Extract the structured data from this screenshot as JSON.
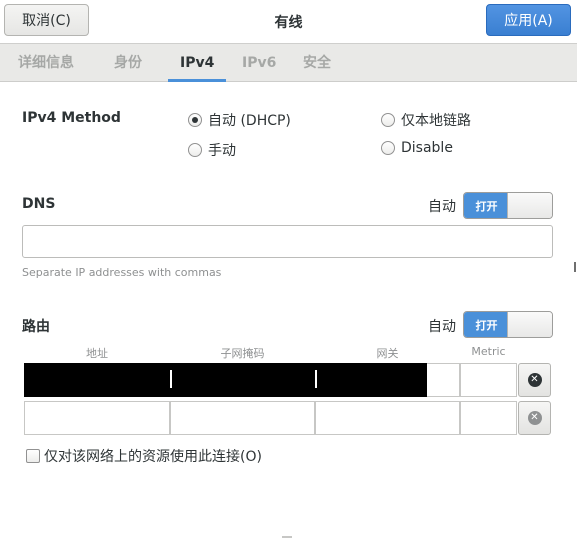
{
  "header": {
    "cancel_label": "取消(C)",
    "title": "有线",
    "apply_label": "应用(A)"
  },
  "tabs": [
    {
      "label": "详细信息",
      "active": false
    },
    {
      "label": "身份",
      "active": false
    },
    {
      "label": "IPv4",
      "active": true
    },
    {
      "label": "IPv6",
      "active": false
    },
    {
      "label": "安全",
      "active": false
    }
  ],
  "ipv4": {
    "method_label": "IPv4 Method",
    "options": [
      {
        "label": "自动 (DHCP)",
        "checked": true
      },
      {
        "label": "仅本地链路",
        "checked": false
      },
      {
        "label": "手动",
        "checked": false
      },
      {
        "label": "Disable",
        "checked": false
      }
    ]
  },
  "dns": {
    "label": "DNS",
    "auto_label": "自动",
    "switch_label": "打开",
    "switch_on": true,
    "input_value": "",
    "hint": "Separate IP addresses with commas"
  },
  "routes": {
    "label": "路由",
    "auto_label": "自动",
    "switch_label": "打开",
    "switch_on": true,
    "columns": [
      "地址",
      "子网掩码",
      "网关",
      "Metric"
    ],
    "rows": [
      {
        "address": "",
        "netmask": "",
        "gateway": "",
        "metric": "",
        "redacted": true
      },
      {
        "address": "",
        "netmask": "",
        "gateway": "",
        "metric": "",
        "redacted": false
      }
    ],
    "delete_icon": "circle-x-icon"
  },
  "restrict": {
    "label": "仅对该网络上的资源使用此连接(O)",
    "checked": false
  },
  "colors": {
    "accent": "#4a90d9",
    "tab_bar": "#e9e9e7",
    "text": "#2e3436"
  }
}
